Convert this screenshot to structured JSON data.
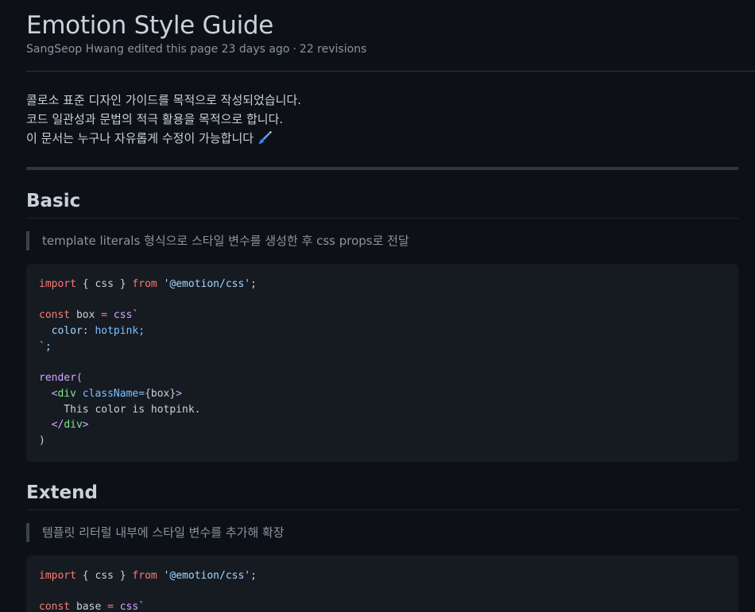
{
  "page": {
    "title": "Emotion Style Guide",
    "author": "SangSeop Hwang",
    "edited_text": "edited this page 23 days ago",
    "separator": "·",
    "revisions": "22 revisions"
  },
  "intro": {
    "line1": "콜로소 표준 디자인 가이드를 목적으로 작성되었습니다.",
    "line2": "코드 일관성과 문법의 적극 활용을 목적으로 합니다.",
    "line3": "이 문서는 누구나 자유롭게 수정이 가능합니다",
    "icon": "paintbrush-icon"
  },
  "sections": {
    "basic": {
      "heading": "Basic",
      "quote": "template literals 형식으로 스타일 변수를 생성한 후 css props로 전달",
      "code": {
        "import_kw": "import",
        "import_names": " { css } ",
        "from_kw": "from",
        "module": "'@emotion/css'",
        "semicolon": ";",
        "const_kw": "const",
        "box_var": " box ",
        "eq": "=",
        "css_fn": " css",
        "backtick_open": "`",
        "color_prop": "  color: ",
        "color_val": "hotpink;",
        "backtick_close": "`;",
        "render_fn": "render(",
        "indent1": "  ",
        "tag_open": "<div ",
        "attr_name": "className=",
        "attr_val": "{box}",
        "tag_gt": ">",
        "body_text": "    This color is hotpink.",
        "tag_close": "</div>",
        "close_paren": ")"
      }
    },
    "extend": {
      "heading": "Extend",
      "quote": "템플릿 리터럴 내부에 스타일 변수를 추가해 확장",
      "code": {
        "import_kw": "import",
        "import_names": " { css } ",
        "from_kw": "from",
        "module": "'@emotion/css'",
        "semicolon": ";",
        "const_kw": "const",
        "base_var": " base ",
        "eq": "=",
        "css_fn": " css",
        "backtick_open": "`"
      }
    }
  },
  "colors": {
    "background": "#0d1117",
    "code_background": "#161b22",
    "keyword": "#ff7b72",
    "string": "#a5d6ff",
    "function": "#d2a8ff",
    "property": "#79c0ff",
    "tag": "#7ee787"
  }
}
